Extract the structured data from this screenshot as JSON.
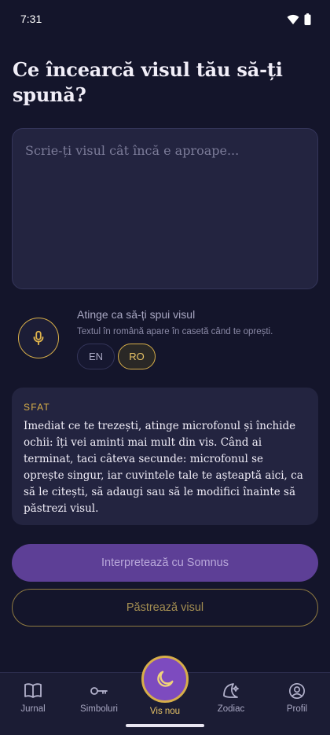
{
  "status_bar": {
    "time": "7:31"
  },
  "page": {
    "title": "Ce încearcă visul tău să-ți spună?"
  },
  "dream_input": {
    "placeholder": "Scrie-ți visul cât încă e aproape...",
    "value": ""
  },
  "voice": {
    "title": "Atinge ca să-ți spui visul",
    "subtitle": "Textul în română apare în casetă când te oprești.",
    "languages": [
      "EN",
      "RO"
    ],
    "selected_language": "RO"
  },
  "tip": {
    "label": "SFAT",
    "text": "Imediat ce te trezești, atinge microfonul și închide ochii: îți vei aminti mai mult din vis. Când ai terminat, taci câteva secunde: microfonul se oprește singur, iar cuvintele tale te așteaptă aici, ca să le citești, să adaugi sau să le modifici înainte să păstrezi visul."
  },
  "actions": {
    "interpret_label": "Interpretează cu Somnus",
    "keep_label": "Păstrează visul"
  },
  "nav": {
    "items": [
      {
        "label": "Jurnal",
        "icon": "book-open-icon"
      },
      {
        "label": "Simboluri",
        "icon": "key-icon"
      },
      {
        "label": "Vis nou",
        "icon": "moon-icon"
      },
      {
        "label": "Zodiac",
        "icon": "moon-stars-icon"
      },
      {
        "label": "Profil",
        "icon": "user-circle-icon"
      }
    ],
    "active": "Vis nou"
  },
  "colors": {
    "background": "#14152b",
    "card": "#232440",
    "gold_accent": "#d7ae49",
    "purple_primary": "#5d3f96",
    "purple_nav": "#7d4bbf"
  }
}
